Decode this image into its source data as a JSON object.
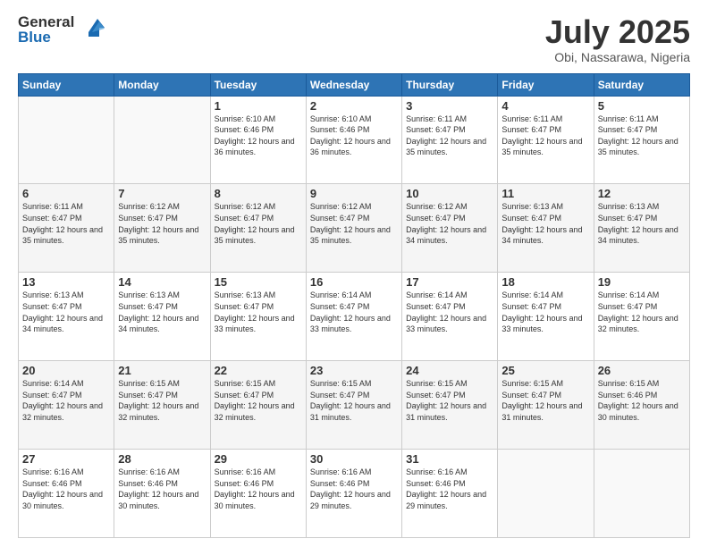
{
  "logo": {
    "general": "General",
    "blue": "Blue"
  },
  "title": "July 2025",
  "subtitle": "Obi, Nassarawa, Nigeria",
  "days_of_week": [
    "Sunday",
    "Monday",
    "Tuesday",
    "Wednesday",
    "Thursday",
    "Friday",
    "Saturday"
  ],
  "weeks": [
    [
      {
        "day": "",
        "sunrise": "",
        "sunset": "",
        "daylight": ""
      },
      {
        "day": "",
        "sunrise": "",
        "sunset": "",
        "daylight": ""
      },
      {
        "day": "1",
        "sunrise": "Sunrise: 6:10 AM",
        "sunset": "Sunset: 6:46 PM",
        "daylight": "Daylight: 12 hours and 36 minutes."
      },
      {
        "day": "2",
        "sunrise": "Sunrise: 6:10 AM",
        "sunset": "Sunset: 6:46 PM",
        "daylight": "Daylight: 12 hours and 36 minutes."
      },
      {
        "day": "3",
        "sunrise": "Sunrise: 6:11 AM",
        "sunset": "Sunset: 6:47 PM",
        "daylight": "Daylight: 12 hours and 35 minutes."
      },
      {
        "day": "4",
        "sunrise": "Sunrise: 6:11 AM",
        "sunset": "Sunset: 6:47 PM",
        "daylight": "Daylight: 12 hours and 35 minutes."
      },
      {
        "day": "5",
        "sunrise": "Sunrise: 6:11 AM",
        "sunset": "Sunset: 6:47 PM",
        "daylight": "Daylight: 12 hours and 35 minutes."
      }
    ],
    [
      {
        "day": "6",
        "sunrise": "Sunrise: 6:11 AM",
        "sunset": "Sunset: 6:47 PM",
        "daylight": "Daylight: 12 hours and 35 minutes."
      },
      {
        "day": "7",
        "sunrise": "Sunrise: 6:12 AM",
        "sunset": "Sunset: 6:47 PM",
        "daylight": "Daylight: 12 hours and 35 minutes."
      },
      {
        "day": "8",
        "sunrise": "Sunrise: 6:12 AM",
        "sunset": "Sunset: 6:47 PM",
        "daylight": "Daylight: 12 hours and 35 minutes."
      },
      {
        "day": "9",
        "sunrise": "Sunrise: 6:12 AM",
        "sunset": "Sunset: 6:47 PM",
        "daylight": "Daylight: 12 hours and 35 minutes."
      },
      {
        "day": "10",
        "sunrise": "Sunrise: 6:12 AM",
        "sunset": "Sunset: 6:47 PM",
        "daylight": "Daylight: 12 hours and 34 minutes."
      },
      {
        "day": "11",
        "sunrise": "Sunrise: 6:13 AM",
        "sunset": "Sunset: 6:47 PM",
        "daylight": "Daylight: 12 hours and 34 minutes."
      },
      {
        "day": "12",
        "sunrise": "Sunrise: 6:13 AM",
        "sunset": "Sunset: 6:47 PM",
        "daylight": "Daylight: 12 hours and 34 minutes."
      }
    ],
    [
      {
        "day": "13",
        "sunrise": "Sunrise: 6:13 AM",
        "sunset": "Sunset: 6:47 PM",
        "daylight": "Daylight: 12 hours and 34 minutes."
      },
      {
        "day": "14",
        "sunrise": "Sunrise: 6:13 AM",
        "sunset": "Sunset: 6:47 PM",
        "daylight": "Daylight: 12 hours and 34 minutes."
      },
      {
        "day": "15",
        "sunrise": "Sunrise: 6:13 AM",
        "sunset": "Sunset: 6:47 PM",
        "daylight": "Daylight: 12 hours and 33 minutes."
      },
      {
        "day": "16",
        "sunrise": "Sunrise: 6:14 AM",
        "sunset": "Sunset: 6:47 PM",
        "daylight": "Daylight: 12 hours and 33 minutes."
      },
      {
        "day": "17",
        "sunrise": "Sunrise: 6:14 AM",
        "sunset": "Sunset: 6:47 PM",
        "daylight": "Daylight: 12 hours and 33 minutes."
      },
      {
        "day": "18",
        "sunrise": "Sunrise: 6:14 AM",
        "sunset": "Sunset: 6:47 PM",
        "daylight": "Daylight: 12 hours and 33 minutes."
      },
      {
        "day": "19",
        "sunrise": "Sunrise: 6:14 AM",
        "sunset": "Sunset: 6:47 PM",
        "daylight": "Daylight: 12 hours and 32 minutes."
      }
    ],
    [
      {
        "day": "20",
        "sunrise": "Sunrise: 6:14 AM",
        "sunset": "Sunset: 6:47 PM",
        "daylight": "Daylight: 12 hours and 32 minutes."
      },
      {
        "day": "21",
        "sunrise": "Sunrise: 6:15 AM",
        "sunset": "Sunset: 6:47 PM",
        "daylight": "Daylight: 12 hours and 32 minutes."
      },
      {
        "day": "22",
        "sunrise": "Sunrise: 6:15 AM",
        "sunset": "Sunset: 6:47 PM",
        "daylight": "Daylight: 12 hours and 32 minutes."
      },
      {
        "day": "23",
        "sunrise": "Sunrise: 6:15 AM",
        "sunset": "Sunset: 6:47 PM",
        "daylight": "Daylight: 12 hours and 31 minutes."
      },
      {
        "day": "24",
        "sunrise": "Sunrise: 6:15 AM",
        "sunset": "Sunset: 6:47 PM",
        "daylight": "Daylight: 12 hours and 31 minutes."
      },
      {
        "day": "25",
        "sunrise": "Sunrise: 6:15 AM",
        "sunset": "Sunset: 6:47 PM",
        "daylight": "Daylight: 12 hours and 31 minutes."
      },
      {
        "day": "26",
        "sunrise": "Sunrise: 6:15 AM",
        "sunset": "Sunset: 6:46 PM",
        "daylight": "Daylight: 12 hours and 30 minutes."
      }
    ],
    [
      {
        "day": "27",
        "sunrise": "Sunrise: 6:16 AM",
        "sunset": "Sunset: 6:46 PM",
        "daylight": "Daylight: 12 hours and 30 minutes."
      },
      {
        "day": "28",
        "sunrise": "Sunrise: 6:16 AM",
        "sunset": "Sunset: 6:46 PM",
        "daylight": "Daylight: 12 hours and 30 minutes."
      },
      {
        "day": "29",
        "sunrise": "Sunrise: 6:16 AM",
        "sunset": "Sunset: 6:46 PM",
        "daylight": "Daylight: 12 hours and 30 minutes."
      },
      {
        "day": "30",
        "sunrise": "Sunrise: 6:16 AM",
        "sunset": "Sunset: 6:46 PM",
        "daylight": "Daylight: 12 hours and 29 minutes."
      },
      {
        "day": "31",
        "sunrise": "Sunrise: 6:16 AM",
        "sunset": "Sunset: 6:46 PM",
        "daylight": "Daylight: 12 hours and 29 minutes."
      },
      {
        "day": "",
        "sunrise": "",
        "sunset": "",
        "daylight": ""
      },
      {
        "day": "",
        "sunrise": "",
        "sunset": "",
        "daylight": ""
      }
    ]
  ]
}
